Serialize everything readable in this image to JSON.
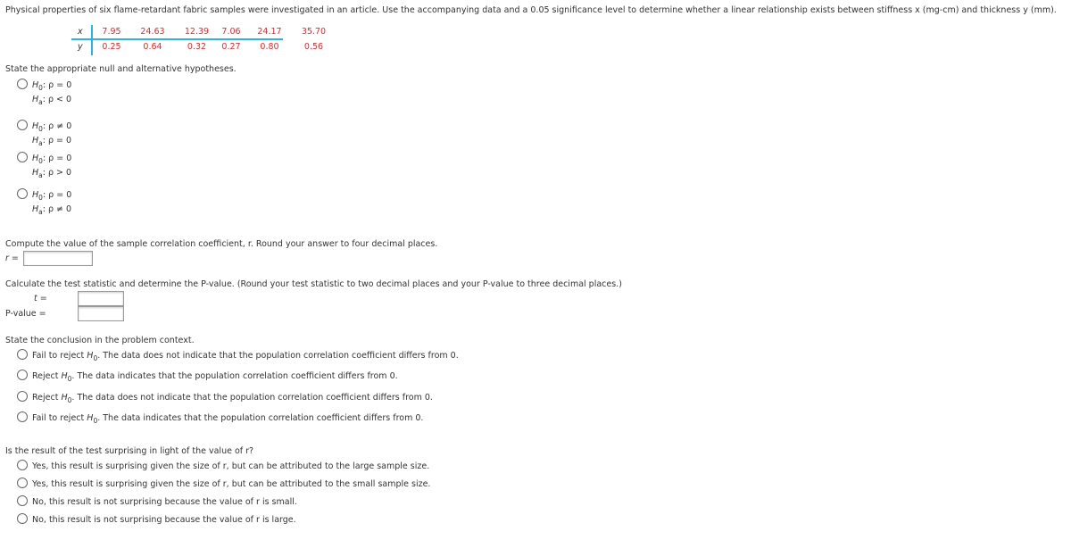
{
  "intro": "Physical properties of six flame-retardant fabric samples were investigated in an article. Use the accompanying data and a 0.05 significance level to determine whether a linear relationship exists between stiffness x (mg-cm) and thickness y (mm).",
  "table": {
    "x_label": "x",
    "y_label": "y",
    "x": [
      "7.95",
      "24.63",
      "12.39",
      "7.06",
      "24.17",
      "35.70"
    ],
    "y": [
      "0.25",
      "0.64",
      "0.32",
      "0.27",
      "0.80",
      "0.56"
    ],
    "accent": "#2fb2e8",
    "value_color": "#e8262a"
  },
  "q1": {
    "prompt": "State the appropriate null and alternative hypotheses.",
    "options": [
      {
        "h0": "ρ = 0",
        "ha": "ρ < 0"
      },
      {
        "h0": "ρ ≠ 0",
        "ha": "ρ = 0"
      },
      {
        "h0": "ρ = 0",
        "ha": "ρ > 0"
      },
      {
        "h0": "ρ = 0",
        "ha": "ρ ≠ 0"
      }
    ]
  },
  "q2": {
    "prompt": "Compute the value of the sample correlation coefficient, r. Round your answer to four decimal places.",
    "label": "r =",
    "value": ""
  },
  "q3": {
    "prompt": "Calculate the test statistic and determine the P-value. (Round your test statistic to two decimal places and your P-value to three decimal places.)",
    "t_label": "t =",
    "p_label": "P-value =",
    "t_value": "",
    "p_value": ""
  },
  "q4": {
    "prompt": "State the conclusion in the problem context.",
    "options": [
      {
        "lead": "Fail to reject",
        "rest": ". The data does not indicate that the population correlation coefficient differs from 0."
      },
      {
        "lead": "Reject",
        "rest": ". The data indicates that the population correlation coefficient differs from 0."
      },
      {
        "lead": "Reject",
        "rest": ". The data does not indicate that the population correlation coefficient differs from 0."
      },
      {
        "lead": "Fail to reject",
        "rest": ". The data indicates that the population correlation coefficient differs from 0."
      }
    ]
  },
  "q5": {
    "prompt": "Is the result of the test surprising in light of the value of r?",
    "options": [
      "Yes, this result is surprising given the size of r, but can be attributed to the large sample size.",
      "Yes, this result is surprising given the size of r, but can be attributed to the small sample size.",
      "No, this result is not surprising because the value of r is small.",
      "No, this result is not surprising because the value of r is large."
    ]
  }
}
